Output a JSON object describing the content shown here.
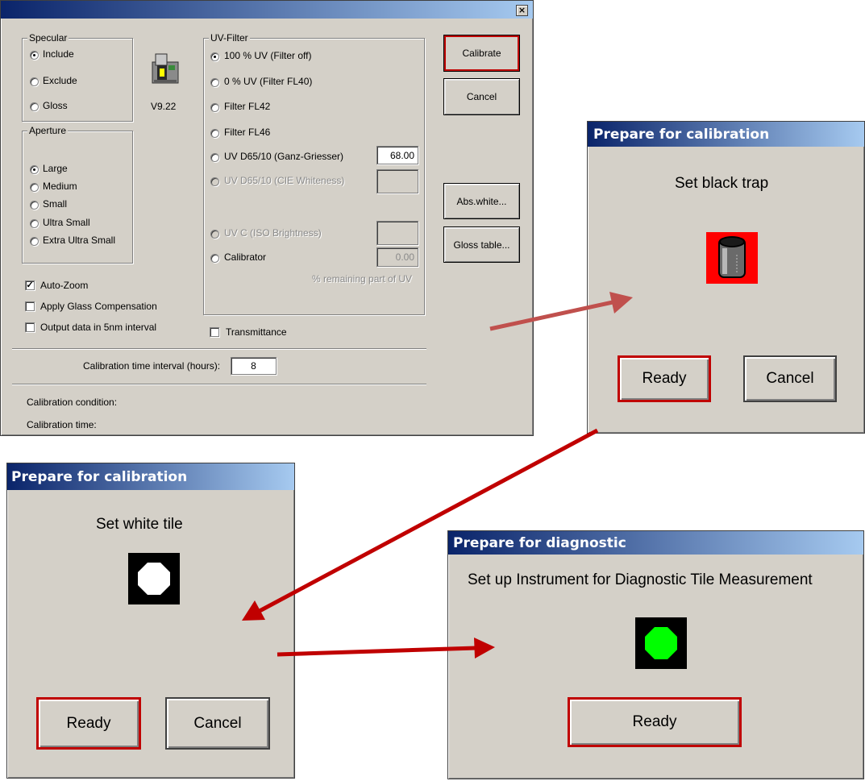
{
  "main_dialog": {
    "close_glyph": "×",
    "specular": {
      "legend": "Specular",
      "options": [
        {
          "label": "Include",
          "checked": true
        },
        {
          "label": "Exclude",
          "checked": false
        },
        {
          "label": "Gloss",
          "checked": false
        }
      ]
    },
    "version": "V9.22",
    "aperture": {
      "legend": "Aperture",
      "options": [
        {
          "label": "Large",
          "checked": true
        },
        {
          "label": "Medium",
          "checked": false
        },
        {
          "label": "Small",
          "checked": false
        },
        {
          "label": "Ultra Small",
          "checked": false
        },
        {
          "label": "Extra Ultra Small",
          "checked": false
        }
      ]
    },
    "checkboxes": [
      {
        "label": "Auto-Zoom",
        "checked": true
      },
      {
        "label": "Apply Glass Compensation",
        "checked": false
      },
      {
        "label": "Output data in 5nm interval",
        "checked": false
      }
    ],
    "uv_filter": {
      "legend": "UV-Filter",
      "options": [
        {
          "label": "100 % UV (Filter off)",
          "checked": true,
          "enabled": true
        },
        {
          "label": "0 % UV (Filter FL40)",
          "checked": false,
          "enabled": true
        },
        {
          "label": "Filter FL42",
          "checked": false,
          "enabled": true
        },
        {
          "label": "Filter FL46",
          "checked": false,
          "enabled": true
        },
        {
          "label": "UV D65/10 (Ganz-Griesser)",
          "checked": false,
          "enabled": true,
          "value": "68.00"
        },
        {
          "label": "UV D65/10 (CIE Whiteness)",
          "checked": false,
          "enabled": false,
          "value": ""
        },
        {
          "label": "UV C (ISO Brightness)",
          "checked": false,
          "enabled": false,
          "value": ""
        },
        {
          "label": "Calibrator",
          "checked": false,
          "enabled": true,
          "value": "0.00"
        }
      ],
      "remaining_note": "% remaining part of UV"
    },
    "transmittance_label": "Transmittance",
    "buttons": {
      "calibrate": "Calibrate",
      "cancel": "Cancel",
      "abs_white": "Abs.white...",
      "gloss_table": "Gloss table..."
    },
    "interval_label": "Calibration time interval (hours):",
    "interval_value": "8",
    "calibration_condition_label": "Calibration condition:",
    "calibration_time_label": "Calibration time:"
  },
  "dialog_black_trap": {
    "title": "Prepare for calibration",
    "message": "Set black trap",
    "icon": "black-trap-icon",
    "ready_label": "Ready",
    "cancel_label": "Cancel"
  },
  "dialog_white_tile": {
    "title": "Prepare for calibration",
    "message": "Set white tile",
    "icon": "white-tile-icon",
    "ready_label": "Ready",
    "cancel_label": "Cancel"
  },
  "dialog_diagnostic": {
    "title": "Prepare for diagnostic",
    "message": "Set up Instrument for Diagnostic Tile Measurement",
    "icon": "diagnostic-tile-icon",
    "ready_label": "Ready"
  },
  "colors": {
    "title_bar_start": "#0a246a",
    "title_bar_end": "#a6caf0",
    "dialog_face": "#d4d0c8",
    "default_button_border": "#c00000",
    "arrow_1": "#c0504d",
    "arrow_2_3_4": "#c00000",
    "diagnostic_tile": "#00ff00"
  }
}
